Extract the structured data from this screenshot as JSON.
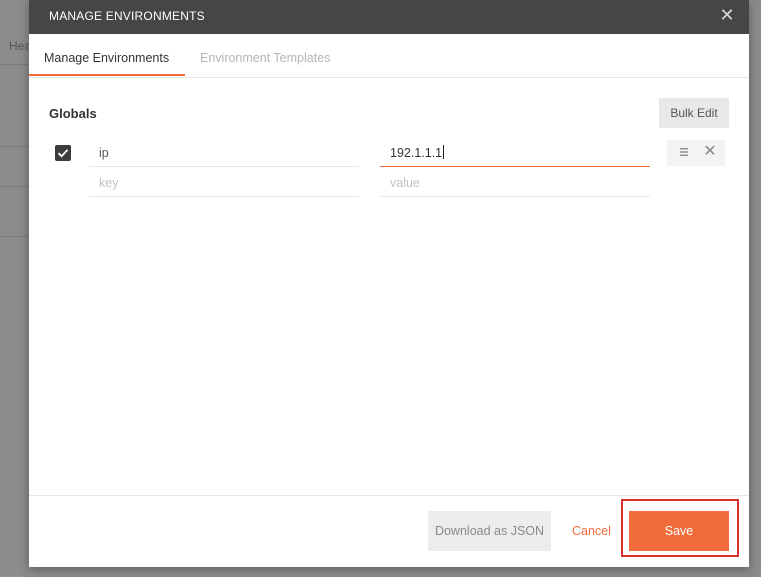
{
  "background": {
    "header_snippet": "Hea"
  },
  "modal": {
    "title": "MANAGE ENVIRONMENTS",
    "close_icon": "close-icon",
    "tabs": [
      {
        "label": "Manage Environments",
        "active": true
      },
      {
        "label": "Environment Templates",
        "active": false
      }
    ],
    "section_title": "Globals",
    "bulk_edit_label": "Bulk Edit",
    "rows": [
      {
        "enabled": true,
        "key": "ip",
        "value": "192.1.1.1"
      },
      {
        "enabled": false,
        "key_placeholder": "key",
        "value_placeholder": "value"
      }
    ],
    "footer": {
      "download_label": "Download as JSON",
      "cancel_label": "Cancel",
      "save_label": "Save"
    }
  },
  "colors": {
    "accent": "#f26b3a",
    "header_bg": "#464646",
    "highlight": "#d9302c"
  }
}
